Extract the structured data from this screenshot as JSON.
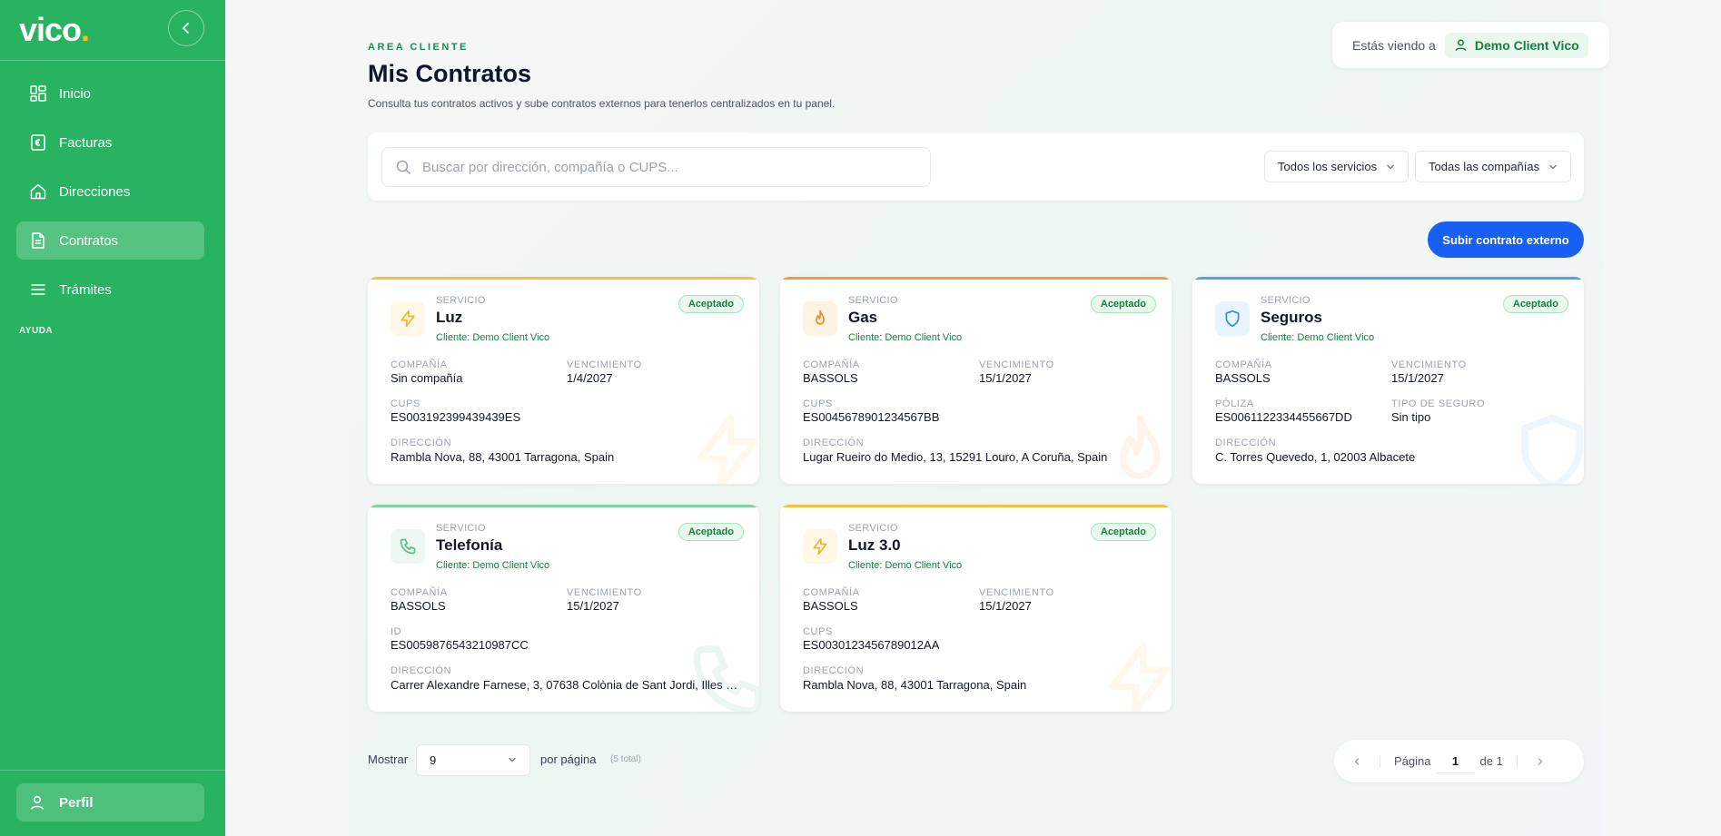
{
  "brand": {
    "logo_text": "vico",
    "logo_dot": ".",
    "accent": "#27b360",
    "primary": "#1760f3"
  },
  "sidebar": {
    "items": [
      {
        "label": "Inicio",
        "icon": "grid-icon"
      },
      {
        "label": "Facturas",
        "icon": "euro-doc-icon"
      },
      {
        "label": "Direcciones",
        "icon": "home-icon"
      },
      {
        "label": "Contratos",
        "icon": "document-icon",
        "active": true
      },
      {
        "label": "Trámites",
        "icon": "menu-icon"
      }
    ],
    "section": "AYUDA",
    "profile": "Perfil"
  },
  "header": {
    "eyebrow": "AREA CLIENTE",
    "title": "Mis Contratos",
    "subtitle": "Consulta tus contratos activos y sube contratos externos para tenerlos centralizados en tu panel.",
    "viewing_label": "Estás viendo a",
    "viewing_client": "Demo Client Vico"
  },
  "filters": {
    "search_placeholder": "Buscar por dirección, compañía o CUPS...",
    "services": "Todos los servicios",
    "companies": "Todas las compañías"
  },
  "upload_button": "Subir contrato externo",
  "contracts": [
    {
      "service_label": "SERVICIO",
      "service": "Luz",
      "client": "Cliente: Demo Client Vico",
      "status": "Aceptado",
      "icon": "bolt-icon",
      "color": "#f6c23e",
      "company_label": "COMPAÑÍA",
      "company": "Sin compañía",
      "expiry_label": "VENCIMIENTO",
      "expiry": "1/4/2027",
      "id_label": "CUPS",
      "id": "ES003192399439439ES",
      "address_label": "DIRECCIÓN",
      "address": "Rambla Nova, 88, 43001 Tarragona, Spain"
    },
    {
      "service_label": "SERVICIO",
      "service": "Gas",
      "client": "Cliente: Demo Client Vico",
      "status": "Aceptado",
      "icon": "flame-icon",
      "color": "#f29d2c",
      "company_label": "COMPAÑÍA",
      "company": "BASSOLS",
      "expiry_label": "VENCIMIENTO",
      "expiry": "15/1/2027",
      "id_label": "CUPS",
      "id": "ES0045678901234567BB",
      "address_label": "DIRECCIÓN",
      "address": "Lugar Rueiro do Medio, 13, 15291 Louro, A Coruña, Spain"
    },
    {
      "service_label": "SERVICIO",
      "service": "Seguros",
      "client": "Cliente: Demo Client Vico",
      "status": "Aceptado",
      "icon": "shield-icon",
      "color": "#4aa3f0",
      "company_label": "COMPAÑÍA",
      "company": "BASSOLS",
      "expiry_label": "VENCIMIENTO",
      "expiry": "15/1/2027",
      "id_label": "PÓLIZA",
      "id": "ES0061122334455667DD",
      "extra_label": "TIPO DE SEGURO",
      "extra": "Sin tipo",
      "address_label": "DIRECCIÓN",
      "address": "C. Torres Quevedo, 1, 02003 Albacete"
    },
    {
      "service_label": "SERVICIO",
      "service": "Telefonía",
      "client": "Cliente: Demo Client Vico",
      "status": "Aceptado",
      "icon": "phone-icon",
      "color": "#7fd3a3",
      "company_label": "COMPAÑÍA",
      "company": "BASSOLS",
      "expiry_label": "VENCIMIENTO",
      "expiry": "15/1/2027",
      "id_label": "ID",
      "id": "ES0059876543210987CC",
      "address_label": "DIRECCIÓN",
      "address": "Carrer Alexandre Farnese, 3, 07638 Colònia de Sant Jordi, Illes Ba..."
    },
    {
      "service_label": "SERVICIO",
      "service": "Luz 3.0",
      "client": "Cliente: Demo Client Vico",
      "status": "Aceptado",
      "icon": "bolt-icon",
      "color": "#f6c23e",
      "company_label": "COMPAÑÍA",
      "company": "BASSOLS",
      "expiry_label": "VENCIMIENTO",
      "expiry": "15/1/2027",
      "id_label": "CUPS",
      "id": "ES0030123456789012AA",
      "address_label": "DIRECCIÓN",
      "address": "Rambla Nova, 88, 43001 Tarragona, Spain"
    }
  ],
  "pagination": {
    "show_label": "Mostrar",
    "per_page": "9",
    "per_page_label": "por página",
    "total": "(5 total)",
    "page_label": "Página",
    "page": "1",
    "of_label": "de 1"
  }
}
